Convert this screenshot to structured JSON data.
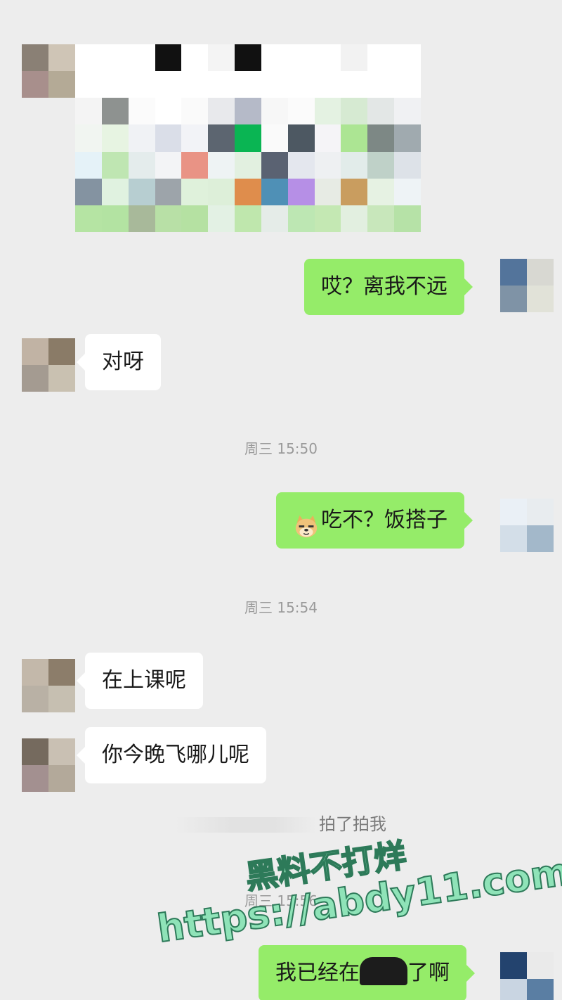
{
  "messages": [
    {
      "side": "left",
      "type": "image"
    },
    {
      "side": "right",
      "type": "text",
      "text": "哎？离我不远"
    },
    {
      "side": "left",
      "type": "text",
      "text": "对呀"
    },
    {
      "type": "timestamp",
      "text": "周三 15:50"
    },
    {
      "side": "right",
      "type": "text",
      "emoji": "doge-icon",
      "text": "吃不？饭搭子"
    },
    {
      "type": "timestamp",
      "text": "周三 15:54"
    },
    {
      "side": "left",
      "type": "text",
      "text": "在上课呢"
    },
    {
      "side": "left",
      "type": "text",
      "text": "你今晚飞哪儿呢"
    },
    {
      "type": "system",
      "text": "拍了拍我"
    },
    {
      "type": "timestamp",
      "text": "周三 15:56"
    },
    {
      "side": "right",
      "type": "text",
      "text_before": "我已经在",
      "text_after": "了啊"
    }
  ],
  "watermark": {
    "line1": "黑料不打烊",
    "line2": "https://abdy11.com"
  },
  "colors": {
    "background": "#ededed",
    "sent_bubble": "#95ec69",
    "received_bubble": "#ffffff",
    "watermark_fill": "#8fe3b8"
  }
}
